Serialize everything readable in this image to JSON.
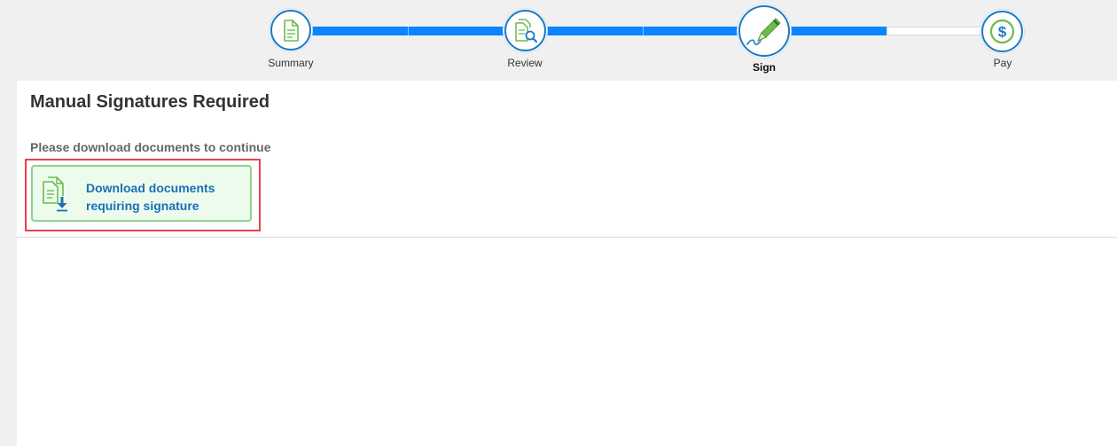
{
  "stepper": {
    "steps": [
      {
        "label": "Summary",
        "icon": "document-icon",
        "state": "complete"
      },
      {
        "label": "Review",
        "icon": "document-search-icon",
        "state": "complete"
      },
      {
        "label": "Sign",
        "icon": "pen-signature-icon",
        "state": "active"
      },
      {
        "label": "Pay",
        "icon": "dollar-icon",
        "state": "upcoming"
      }
    ]
  },
  "main": {
    "title": "Manual Signatures Required",
    "instruction": "Please download documents to continue",
    "download_button": {
      "line1": "Download documents",
      "line2": "requiring signature",
      "icon": "document-download-icon"
    }
  },
  "colors": {
    "progress_blue": "#0a84ff",
    "circle_border": "#1f7ac0",
    "icon_green": "#6dbb4f",
    "button_bg": "#ecfbec",
    "button_border": "#8ed48e",
    "link_blue": "#1a6fb8",
    "highlight_red": "#e8414b"
  }
}
